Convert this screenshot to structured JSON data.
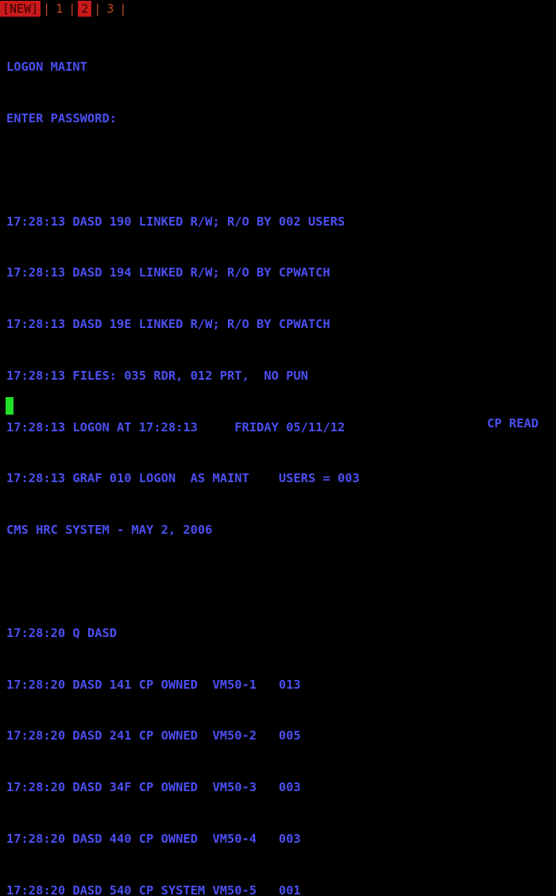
{
  "tabs": {
    "new_label": "[NEW]",
    "items": [
      {
        "label": "1"
      },
      {
        "label": "2"
      },
      {
        "label": "3"
      }
    ],
    "separator": "|",
    "active_index": 1
  },
  "screen": {
    "lines": [
      "LOGON MAINT",
      "ENTER PASSWORD:",
      "",
      "17:28:13 DASD 190 LINKED R/W; R/O BY 002 USERS",
      "17:28:13 DASD 194 LINKED R/W; R/O BY CPWATCH",
      "17:28:13 DASD 19E LINKED R/W; R/O BY CPWATCH",
      "17:28:13 FILES: 035 RDR, 012 PRT,  NO PUN",
      "17:28:13 LOGON AT 17:28:13     FRIDAY 05/11/12",
      "17:28:13 GRAF 010 LOGON  AS MAINT    USERS = 003",
      "CMS HRC SYSTEM - MAY 2, 2006",
      "",
      "17:28:20 Q DASD",
      "17:28:20 DASD 141 CP OWNED  VM50-1   013",
      "17:28:20 DASD 241 CP OWNED  VM50-2   005",
      "17:28:20 DASD 34F CP OWNED  VM50-3   003",
      "17:28:20 DASD 440 CP OWNED  VM50-4   003",
      "17:28:20 DASD 540 CP SYSTEM VM50-5   001"
    ]
  },
  "status": {
    "text": "CP READ"
  },
  "colors": {
    "background": "#000000",
    "terminal_text": "#4a4ff0",
    "cursor": "#22e02a",
    "tab_active": "#c81a1a",
    "tab_text": "#c24a24"
  }
}
